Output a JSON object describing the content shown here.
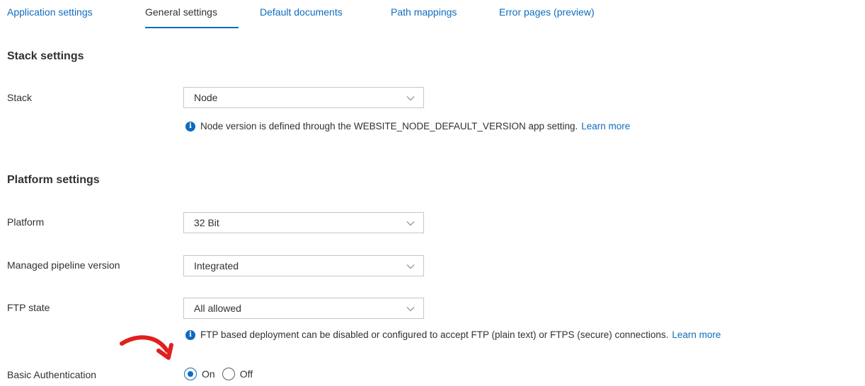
{
  "tabs": [
    {
      "label": "Application settings",
      "active": false
    },
    {
      "label": "General settings",
      "active": true
    },
    {
      "label": "Default documents",
      "active": false
    },
    {
      "label": "Path mappings",
      "active": false
    },
    {
      "label": "Error pages (preview)",
      "active": false
    }
  ],
  "stack_section": {
    "title": "Stack settings",
    "stack": {
      "label": "Stack",
      "value": "Node"
    },
    "info": {
      "text": "Node version is defined through the WEBSITE_NODE_DEFAULT_VERSION app setting.",
      "link": "Learn more"
    }
  },
  "platform_section": {
    "title": "Platform settings",
    "platform": {
      "label": "Platform",
      "value": "32 Bit"
    },
    "pipeline": {
      "label": "Managed pipeline version",
      "value": "Integrated"
    },
    "ftp": {
      "label": "FTP state",
      "value": "All allowed"
    },
    "ftp_info": {
      "text": "FTP based deployment can be disabled or configured to accept FTP (plain text) or FTPS (secure) connections.",
      "link": "Learn more"
    },
    "basic_auth": {
      "label": "Basic Authentication",
      "on_label": "On",
      "off_label": "Off",
      "selected": "On"
    }
  },
  "colors": {
    "accent": "#0f6cbd",
    "annotation_arrow": "#e0201f",
    "text": "#323130"
  },
  "icons": {
    "info": "info-icon",
    "dropdown": "chevron-down-icon"
  }
}
